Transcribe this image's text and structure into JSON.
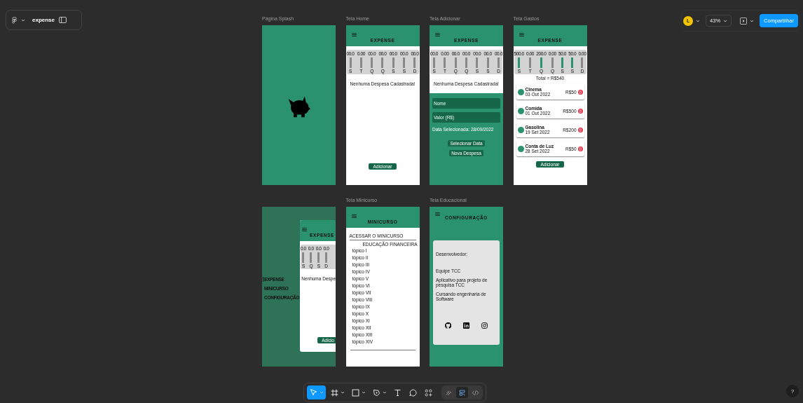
{
  "file_bar": {
    "file_name": "expense"
  },
  "share_bar": {
    "avatar": "L",
    "zoom": "43%",
    "share": "Compartilhar"
  },
  "frames": [
    {
      "kind": "splash",
      "label": "Página Splash"
    },
    {
      "kind": "home",
      "label": "Tela Home",
      "title": "EXPENSE",
      "bars": [
        {
          "value": "00.0",
          "day": "S",
          "active": false
        },
        {
          "value": "0.00",
          "day": "T",
          "active": false
        },
        {
          "value": "00.0",
          "day": "Q",
          "active": false
        },
        {
          "value": "00.0",
          "day": "Q",
          "active": false
        },
        {
          "value": "00.0",
          "day": "S",
          "active": false
        },
        {
          "value": "00.0",
          "day": "S",
          "active": false
        },
        {
          "value": "00.0",
          "day": "D",
          "active": false
        }
      ],
      "empty": "Nenhuma Despesa Cadastrada!",
      "button": "Adicionar"
    },
    {
      "kind": "add",
      "label": "Tela Adicionar",
      "title": "EXPENSE",
      "bars": [
        {
          "value": "00.0",
          "day": "S",
          "active": false
        },
        {
          "value": "0.00",
          "day": "T",
          "active": false
        },
        {
          "value": "00.0",
          "day": "Q",
          "active": false
        },
        {
          "value": "00.0",
          "day": "Q",
          "active": false
        },
        {
          "value": "00.0",
          "day": "S",
          "active": false
        },
        {
          "value": "00.0",
          "day": "S",
          "active": false
        },
        {
          "value": "00.0",
          "day": "D",
          "active": false
        }
      ],
      "empty": "Nenhuma Despesa Cadastrada!",
      "fields": [
        {
          "placeholder": "Nome"
        },
        {
          "placeholder": "Valor (R$)"
        }
      ],
      "date": "Data Selecionada: 28/09/2022",
      "buttons": [
        "Selecionar Data",
        "Nova Despesa"
      ]
    },
    {
      "kind": "expenses",
      "label": "Tela Gastos",
      "title": "EXPENSE",
      "bars": [
        {
          "value": "500.0",
          "day": "S",
          "active": true
        },
        {
          "value": "0.00",
          "day": "T",
          "active": false
        },
        {
          "value": "200.0",
          "day": "Q",
          "active": true
        },
        {
          "value": "0.00",
          "day": "Q",
          "active": false
        },
        {
          "value": "50.0",
          "day": "S",
          "active": true
        },
        {
          "value": "50.0",
          "day": "S",
          "active": true
        },
        {
          "value": "0.00",
          "day": "D",
          "active": false
        }
      ],
      "total": "Total = R$540",
      "items": [
        {
          "name": "Cinema",
          "date": "03 Out 2022",
          "amount": "R$50"
        },
        {
          "name": "Comida",
          "date": "01 Out 2022",
          "amount": "R$500"
        },
        {
          "name": "Gasolina",
          "date": "19 Set 2022",
          "amount": "R$200"
        },
        {
          "name": "Conta de Luz",
          "date": "28 Set 2022",
          "amount": "R$50"
        }
      ],
      "button": "Adicionar"
    },
    {
      "kind": "drawer",
      "menu": [
        {
          "label": "EXPENSE",
          "selected": true
        },
        {
          "label": "MINICURSO",
          "selected": false
        },
        {
          "label": "CONFIGURAÇÃO",
          "selected": false
        }
      ],
      "title": "EXPENSE",
      "bars": [
        {
          "value": "0.0",
          "day": "S",
          "active": false
        },
        {
          "value": "0.0",
          "day": "Q",
          "active": false
        },
        {
          "value": "0.0",
          "day": "S",
          "active": false
        },
        {
          "value": "0.0",
          "day": "D",
          "active": false
        }
      ],
      "empty": "Nenhuma Despe",
      "button": "Adicio"
    },
    {
      "kind": "course",
      "label": "Tela Minicurso",
      "title": "MINICURSO",
      "heading": "ACESSAR O MINICURSO",
      "section": "EDUCAÇÃO FINANCEIRA",
      "topics": [
        "tópico I",
        "tópico II",
        "tópico III",
        "tópico IV",
        "tópico V",
        "tópico VI",
        "tópico VII",
        "tópico VIII",
        "tópico IX",
        "tópico X",
        "tópico XI",
        "tópico XII",
        "tópico XIII",
        "tópico XIV"
      ]
    },
    {
      "kind": "info",
      "label": "Tela Educacional",
      "title": "CONFIGURAÇÃO",
      "lines": [
        "Desenvolvedor:",
        "Equipe TCC",
        "Aplicativo para projeto de pesquisa TCC",
        "Cursando engenharia de Software"
      ]
    }
  ],
  "tools": [
    {
      "kind": "move",
      "selected": true,
      "caret": true
    },
    {
      "kind": "frame",
      "selected": false,
      "caret": true
    },
    {
      "kind": "rectangle",
      "selected": false,
      "caret": true
    },
    {
      "kind": "pen",
      "selected": false,
      "caret": true
    },
    {
      "kind": "text",
      "selected": false,
      "caret": false
    },
    {
      "kind": "comment",
      "selected": false,
      "caret": false
    },
    {
      "kind": "actions",
      "selected": false,
      "caret": false
    }
  ],
  "modes": [
    {
      "kind": "draw",
      "selected": false
    },
    {
      "kind": "design",
      "selected": true
    },
    {
      "kind": "code",
      "selected": false
    }
  ],
  "help": "?"
}
